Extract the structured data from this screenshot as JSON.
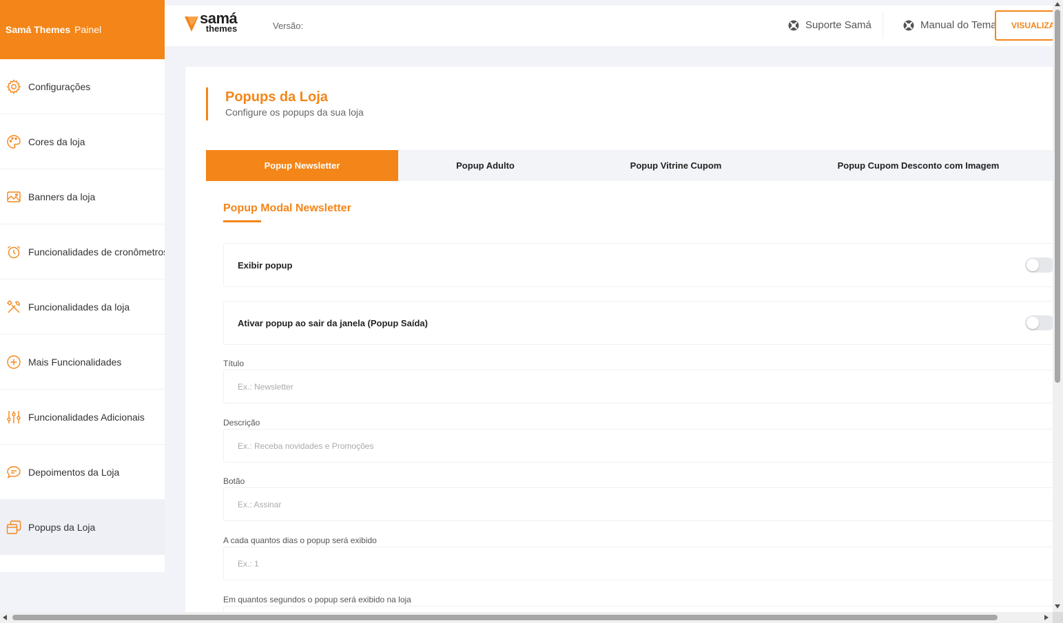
{
  "colors": {
    "accent": "#f48518",
    "sidebar_active_bg": "#eef0f6",
    "page_bg": "#f2f3f8"
  },
  "sidebar": {
    "brand": "Samá Themes",
    "panel": "Painel",
    "items": [
      {
        "label": "Configurações",
        "icon": "gear-icon"
      },
      {
        "label": "Cores da loja",
        "icon": "palette-icon"
      },
      {
        "label": "Banners da loja",
        "icon": "image-icon"
      },
      {
        "label": "Funcionalidades de cronômetros",
        "icon": "alarm-clock-icon"
      },
      {
        "label": "Funcionalidades da loja",
        "icon": "tools-icon"
      },
      {
        "label": "Mais Funcionalidades",
        "icon": "plus-circle-icon"
      },
      {
        "label": "Funcionalidades Adicionais",
        "icon": "sliders-icon"
      },
      {
        "label": "Depoimentos da Loja",
        "icon": "chat-bubble-icon"
      },
      {
        "label": "Popups da Loja",
        "icon": "popup-window-icon",
        "active": true
      }
    ]
  },
  "topbar": {
    "logo_top": "samá",
    "logo_bottom": "themes",
    "version_label": "Versão:",
    "support_link": "Suporte Samá",
    "manual_link": "Manual do Tema",
    "view_button": "VISUALIZAR LOJA"
  },
  "page": {
    "title": "Popups da Loja",
    "subtitle": "Configure os popups da sua loja"
  },
  "tabs": [
    {
      "label": "Popup Newsletter",
      "active": true
    },
    {
      "label": "Popup Adulto",
      "active": false
    },
    {
      "label": "Popup Vitrine Cupom",
      "active": false
    },
    {
      "label": "Popup Cupom Desconto com Imagem",
      "active": false
    }
  ],
  "section": {
    "title": "Popup Modal Newsletter",
    "toggles": [
      {
        "label": "Exibir popup",
        "on": false
      },
      {
        "label": "Ativar popup ao sair da janela (Popup Saída)",
        "on": false
      }
    ],
    "fields": [
      {
        "label": "Título",
        "placeholder": "Ex.: Newsletter",
        "value": ""
      },
      {
        "label": "Descrição",
        "placeholder": "Ex.: Receba novidades e Promoções",
        "value": ""
      },
      {
        "label": "Botão",
        "placeholder": "Ex.: Assinar",
        "value": ""
      },
      {
        "label": "A cada quantos dias o popup será exibido",
        "placeholder": "Ex.: 1",
        "value": ""
      },
      {
        "label": "Em quantos segundos o popup será exibido na loja",
        "placeholder": "",
        "value": ""
      }
    ]
  }
}
